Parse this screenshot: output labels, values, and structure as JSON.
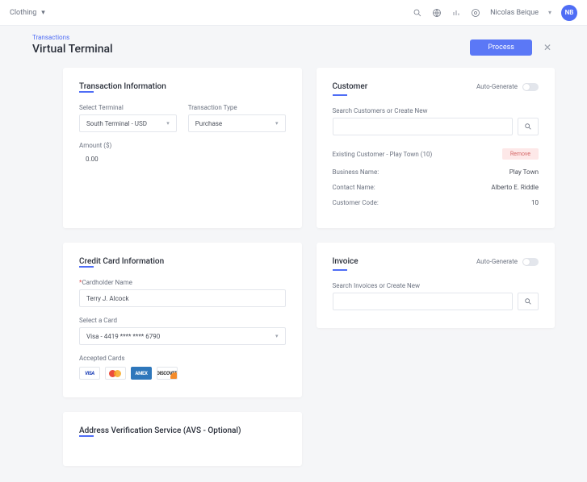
{
  "topbar": {
    "org": "Clothing",
    "user_name": "Nicolas Beique",
    "avatar_initials": "NB"
  },
  "header": {
    "breadcrumb": "Transactions",
    "title": "Virtual Terminal",
    "process_label": "Process"
  },
  "transaction_info": {
    "title": "Transaction Information",
    "terminal_label": "Select Terminal",
    "terminal_value": "South Terminal - USD",
    "type_label": "Transaction Type",
    "type_value": "Purchase",
    "amount_label": "Amount ($)",
    "amount_value": "0.00"
  },
  "customer": {
    "title": "Customer",
    "autogen_label": "Auto-Generate",
    "search_label": "Search Customers or Create New",
    "existing_label": "Existing Customer - Play Town (10)",
    "remove_label": "Remove",
    "fields": {
      "business_name_label": "Business Name:",
      "business_name_value": "Play Town",
      "contact_name_label": "Contact Name:",
      "contact_name_value": "Alberto E. Riddle",
      "customer_code_label": "Customer Code:",
      "customer_code_value": "10"
    }
  },
  "cc": {
    "title": "Credit Card Information",
    "cardholder_label": "Cardholder Name",
    "cardholder_value": "Terry J. Alcock",
    "select_card_label": "Select a Card",
    "select_card_value": "Visa - 4419 **** **** 6790",
    "accepted_label": "Accepted Cards",
    "logos": {
      "visa": "VISA",
      "amex": "AMEX",
      "discover": "DISCOVER"
    }
  },
  "invoice": {
    "title": "Invoice",
    "autogen_label": "Auto-Generate",
    "search_label": "Search Invoices or Create New"
  },
  "avs": {
    "title": "Address Verification Service (AVS - Optional)"
  }
}
